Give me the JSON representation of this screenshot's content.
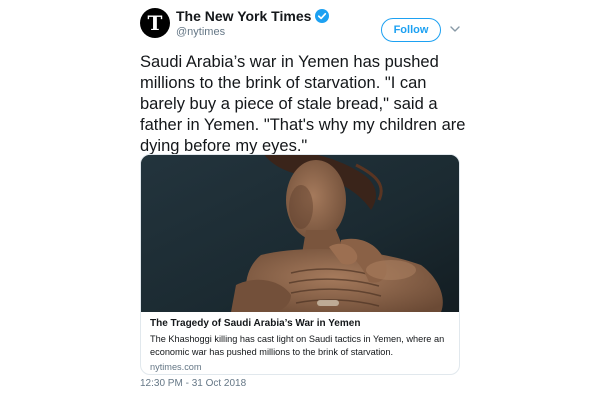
{
  "account": {
    "display_name": "The New York Times",
    "handle": "@nytimes",
    "avatar_glyph": "T",
    "verified_icon": "verified-badge-icon",
    "verified_color": "#1da1f2"
  },
  "actions": {
    "follow_label": "Follow",
    "more_icon": "chevron-down-icon"
  },
  "tweet": {
    "text": "Saudi Arabia’s war in Yemen has pushed millions to the brink of starvation. \"I can barely buy a piece of stale bread,\" said a father in Yemen. \"That's why my children are dying before my eyes.\"",
    "timestamp": "12:30 PM - 31 Oct 2018"
  },
  "card": {
    "title": "The Tragedy of Saudi Arabia’s War in Yemen",
    "description": "The Khashoggi killing has cast light on Saudi tactics in Yemen, where an economic war has pushed millions to the brink of starvation.",
    "domain": "nytimes.com"
  },
  "colors": {
    "accent": "#1da1f2",
    "text": "#14171a",
    "secondary_text": "#657786",
    "border": "#e1e8ed"
  }
}
